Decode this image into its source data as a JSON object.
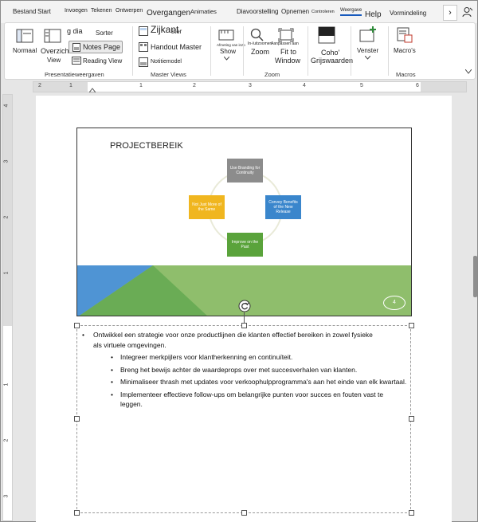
{
  "tabs": [
    {
      "label": "Bestand"
    },
    {
      "label": "Start"
    },
    {
      "label": "Invoegen"
    },
    {
      "label": "Tekenen"
    },
    {
      "label": "Ontwerpen"
    },
    {
      "label": "Overgangen"
    },
    {
      "label": "Animaties"
    },
    {
      "label": "Diavoorstelling"
    },
    {
      "label": "Opnemen"
    },
    {
      "label": "Controleren"
    },
    {
      "label": "Weergave"
    },
    {
      "label": "Help"
    },
    {
      "label": "Vormindeling"
    }
  ],
  "tabs_more": "›",
  "ribbon": {
    "normaal": "Normaal",
    "overzicht": "Overzicht",
    "view": "View",
    "sorter": "Sorter",
    "g_dia": "g dia",
    "notes_page": "Notes Page",
    "reading_view": "Reading View",
    "group_presentatie": "Presentatieweergaven",
    "zijkant": "Zijkant",
    "zijkant_suffix": "ster",
    "handout_master": "Handout Master",
    "notitiemodel": "Notitiemodel",
    "group_master": "Master Views",
    "show": "Show",
    "afmeting": "Afmeting van inzo",
    "in_uitzoomen": "In-/uitzoomen",
    "aanpassen": "Aanpassen aan",
    "zoom": "Zoom",
    "fit_to": "Fit to",
    "window": "Window",
    "group_zoom": "Zoom",
    "coho": "Coho'",
    "grijswaarden": "Grijswaarden",
    "venster": "Venster",
    "macros": "Macro's",
    "group_macros": "Macros"
  },
  "ruler": {
    "h_ticks": [
      "2",
      "1",
      "1",
      "2",
      "3",
      "4",
      "5",
      "6"
    ],
    "v_ticks": [
      "4",
      "3",
      "2",
      "1",
      "1",
      "2",
      "3"
    ]
  },
  "slide": {
    "title": "PROJECTBEREIK",
    "box_top": "Use Branding for Continuity",
    "box_left": "Not Just More of the Same",
    "box_right": "Convey Benefits of the New Release",
    "box_bottom": "Improve on the Past",
    "number": "4"
  },
  "notes": {
    "main": "Ontwikkel een strategie voor onze productlijnen die klanten effectief bereiken in zowel fysieke als virtuele omgevingen.",
    "sub": [
      "Integreer merkpijlers voor klantherkenning en continuïteit.",
      "Breng het bewijs achter de waardeprops over met succesverhalen van klanten.",
      "Minimaliseer thrash met updates voor verkoophulpprogramma's aan het einde van elk kwartaal.",
      "Implementeer effectieve follow-ups om belangrijke punten voor succes en fouten vast te leggen."
    ]
  },
  "colors": {
    "blue": "#4f94d4",
    "green": "#8fbe6c",
    "dark_green": "#6aac55",
    "gray_box": "#8c8c8c",
    "yellow_box": "#f0b61f",
    "blue_box": "#3a86cc",
    "green_box": "#5aa33b"
  }
}
